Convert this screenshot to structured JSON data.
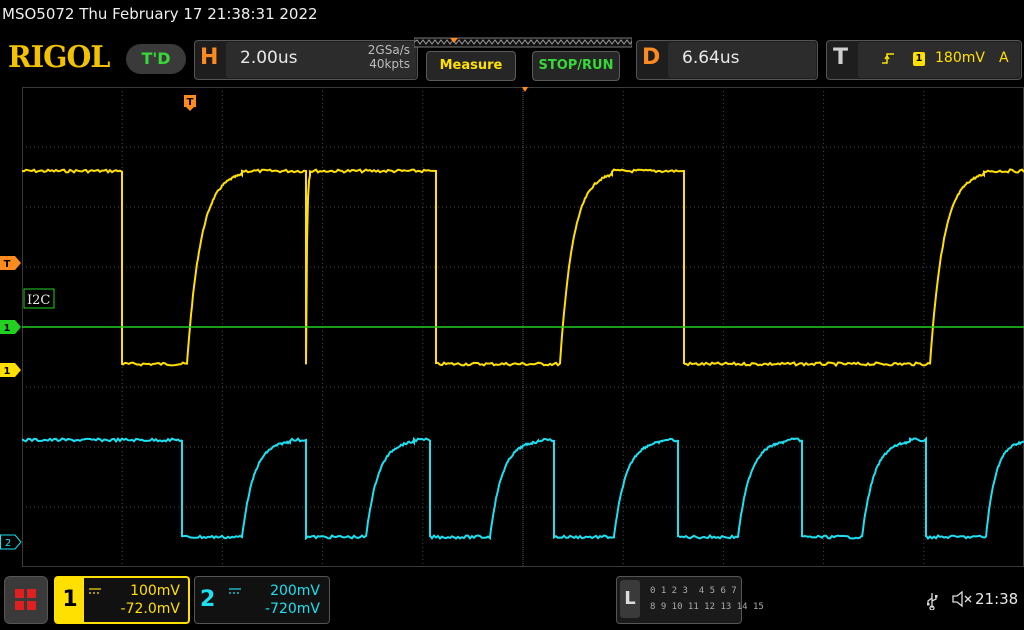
{
  "header": {
    "title": "MSO5072  Thu February 17 21:38:31 2022",
    "brand": "RIGOL",
    "trigger_status": "T'D"
  },
  "horizontal": {
    "letter": "H",
    "timebase": "2.00us",
    "sample_rate": "2GSa/s",
    "memory_depth": "40kpts"
  },
  "buttons": {
    "measure": "Measure",
    "stop_run": "STOP/RUN"
  },
  "delay": {
    "letter": "D",
    "value": "6.64us"
  },
  "trigger": {
    "letter": "T",
    "channel_badge": "1",
    "level": "180mV",
    "source": "A"
  },
  "screen": {
    "decode_label": "I2C",
    "markers": {
      "trigger_level": "T",
      "bus": "1",
      "ch1": "1",
      "ch2": "2",
      "trigger_pos": "T"
    }
  },
  "channels": [
    {
      "number": "1",
      "scale": "100mV",
      "offset": "-72.0mV",
      "color": "#ffe000"
    },
    {
      "number": "2",
      "scale": "200mV",
      "offset": "-720mV",
      "color": "#1ee0f0"
    }
  ],
  "logic": {
    "letter": "L",
    "row1": "0 1 2 3  4 5 6 7",
    "row2": "8 9 10 11 12 13 14 15"
  },
  "status": {
    "clock": "21:38"
  },
  "colors": {
    "ch1": "#ffe000",
    "ch2": "#1ee0f0",
    "bus": "#22d022",
    "trigger": "#ff8a1f",
    "grid": "#5a5a5a"
  }
}
